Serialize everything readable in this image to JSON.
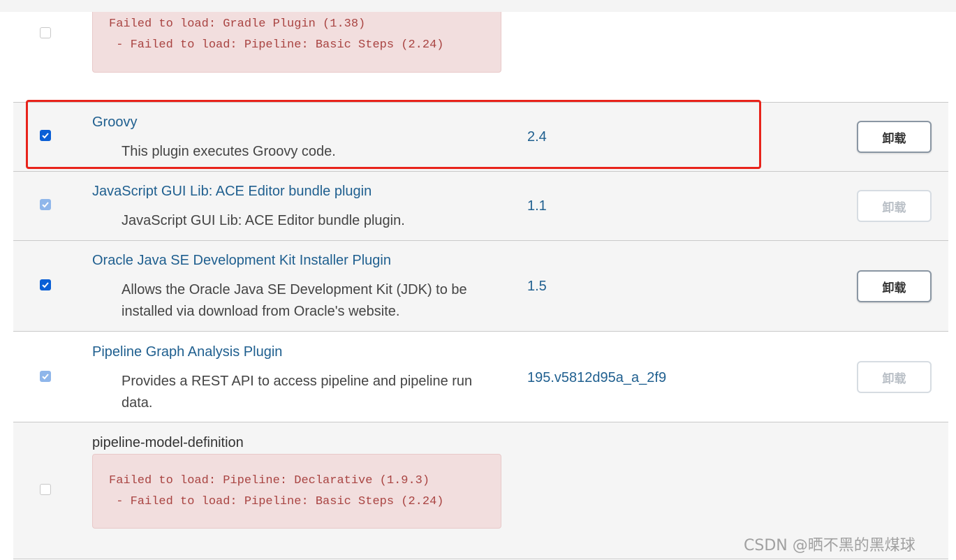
{
  "plugins": [
    {
      "name": "",
      "errors": [
        "Failed to load: Gradle Plugin (1.38)",
        " - Failed to load: Pipeline: Basic Steps (2.24)"
      ],
      "checked": false
    },
    {
      "name": "Groovy",
      "description": "This plugin executes Groovy code.",
      "version": "2.4",
      "checked": true,
      "uninstall_label": "卸载",
      "uninstall_enabled": true
    },
    {
      "name": "JavaScript GUI Lib: ACE Editor bundle plugin",
      "description": "JavaScript GUI Lib: ACE Editor bundle plugin.",
      "version": "1.1",
      "checked": true,
      "uninstall_label": "卸载",
      "uninstall_enabled": false
    },
    {
      "name": "Oracle Java SE Development Kit Installer Plugin",
      "description": "Allows the Oracle Java SE Development Kit (JDK) to be installed via download from Oracle's website.",
      "version": "1.5",
      "checked": true,
      "uninstall_label": "卸载",
      "uninstall_enabled": true
    },
    {
      "name": "Pipeline Graph Analysis Plugin",
      "description": "Provides a REST API to access pipeline and pipeline run data.",
      "version": "195.v5812d95a_a_2f9",
      "checked": true,
      "uninstall_label": "卸载",
      "uninstall_enabled": false
    },
    {
      "name": "pipeline-model-definition",
      "errors": [
        "Failed to load: Pipeline: Declarative (1.9.3)",
        " - Failed to load: Pipeline: Basic Steps (2.24)"
      ],
      "checked": false
    }
  ],
  "watermark": "CSDN @晒不黑的黑煤球",
  "colors": {
    "link": "#1f5f8f",
    "checkbox": "#0a5fd6",
    "error_bg": "#f2dede",
    "error_text": "#a94442",
    "highlight": "#e8231b"
  }
}
